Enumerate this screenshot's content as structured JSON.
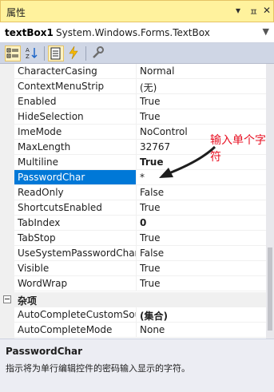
{
  "window": {
    "title": "属性",
    "controls": [
      "▾",
      "ㅍ",
      "✕"
    ]
  },
  "object": {
    "name": "textBox1",
    "type": "System.Windows.Forms.TextBox"
  },
  "toolbar": {
    "buttons": [
      "categorized-icon",
      "alphabetical-icon",
      "properties-icon",
      "events-icon",
      "property-pages-icon"
    ]
  },
  "properties": [
    {
      "name": "CharacterCasing",
      "value": "Normal",
      "bold": false
    },
    {
      "name": "ContextMenuStrip",
      "value": "(无)",
      "bold": false
    },
    {
      "name": "Enabled",
      "value": "True",
      "bold": false
    },
    {
      "name": "HideSelection",
      "value": "True",
      "bold": false
    },
    {
      "name": "ImeMode",
      "value": "NoControl",
      "bold": false
    },
    {
      "name": "MaxLength",
      "value": "32767",
      "bold": false
    },
    {
      "name": "Multiline",
      "value": "True",
      "bold": true
    },
    {
      "name": "PasswordChar",
      "value": "*",
      "bold": false,
      "selected": true
    },
    {
      "name": "ReadOnly",
      "value": "False",
      "bold": false
    },
    {
      "name": "ShortcutsEnabled",
      "value": "True",
      "bold": false
    },
    {
      "name": "TabIndex",
      "value": "0",
      "bold": true
    },
    {
      "name": "TabStop",
      "value": "True",
      "bold": false
    },
    {
      "name": "UseSystemPasswordChar",
      "value": "False",
      "bold": false
    },
    {
      "name": "Visible",
      "value": "True",
      "bold": false
    },
    {
      "name": "WordWrap",
      "value": "True",
      "bold": false
    }
  ],
  "category": {
    "name": "杂项"
  },
  "misc_properties": [
    {
      "name": "AutoCompleteCustomSource",
      "value": "(集合)",
      "bold": true
    },
    {
      "name": "AutoCompleteMode",
      "value": "None",
      "bold": false
    }
  ],
  "annotation": {
    "text": "输入单个字符",
    "color": "#e81123"
  },
  "description": {
    "name": "PasswordChar",
    "text": "指示将为单行编辑控件的密码输入显示的字符。"
  },
  "colors": {
    "selection": "#0078d7",
    "titlebar": "#fff29d",
    "toolbar": "#cfd6e5"
  }
}
